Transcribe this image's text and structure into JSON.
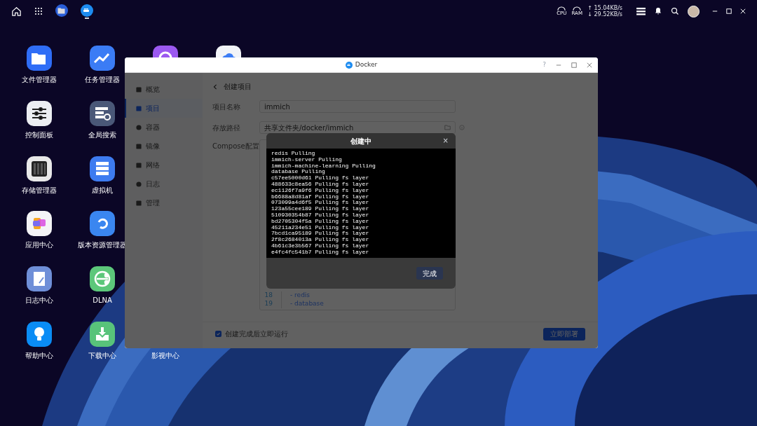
{
  "taskbar": {
    "apps": [
      {
        "kind": "files",
        "selected": false
      },
      {
        "kind": "docker",
        "selected": true
      }
    ],
    "cpu_label": "CPU",
    "ram_label": "RAM",
    "upload": "↑ 15.04KB/s",
    "download": "↓ 29.52KB/s"
  },
  "desktop": {
    "columns": [
      [
        {
          "kind": "files",
          "label": "文件管理器"
        },
        {
          "kind": "control",
          "label": "控制面板"
        },
        {
          "kind": "storage",
          "label": "存储管理器"
        },
        {
          "kind": "apps",
          "label": "应用中心"
        },
        {
          "kind": "logs",
          "label": "日志中心"
        },
        {
          "kind": "help",
          "label": "帮助中心"
        }
      ],
      [
        {
          "kind": "tasks",
          "label": "任务管理器"
        },
        {
          "kind": "search",
          "label": "全局搜索"
        },
        {
          "kind": "vm",
          "label": "虚拟机"
        },
        {
          "kind": "versions",
          "label": "版本资源管理器"
        },
        {
          "kind": "dlna",
          "label": "DLNA"
        },
        {
          "kind": "download",
          "label": "下载中心"
        }
      ],
      [
        {
          "kind": "player"
        },
        {
          "label": "影视中心"
        }
      ],
      [
        {
          "kind": "cloud"
        }
      ]
    ]
  },
  "window": {
    "title": "Docker",
    "help": "?",
    "sidebar": [
      {
        "label": "概览",
        "selected": false
      },
      {
        "label": "项目",
        "selected": true
      },
      {
        "label": "容器",
        "selected": false
      },
      {
        "label": "镜像",
        "selected": false
      },
      {
        "label": "网络",
        "selected": false
      },
      {
        "label": "日志",
        "selected": false
      },
      {
        "label": "管理",
        "selected": false
      }
    ],
    "page_title": "创建项目",
    "fields": [
      {
        "label": "项目名称",
        "value": "immich"
      },
      {
        "label": "存放路径",
        "value": "共享文件夹/docker/immich"
      }
    ],
    "compose_label": "Compose配置",
    "code_lines": [
      {
        "number": "18",
        "text": "- redis",
        "indent": true
      },
      {
        "number": "19",
        "text": "- database",
        "indent": true
      }
    ],
    "run_after": {
      "label": "创建完成后立即运行",
      "checked": true
    },
    "deploy_button": "立即部署"
  },
  "dialog": {
    "title": "创建中",
    "close": "×",
    "log": [
      "redis Pulling",
      "immich-server Pulling",
      "immich-machine-learning Pulling",
      "database Pulling",
      "c57ee5000d61 Pulling fs layer",
      "488633c8ea56 Pulling fs layer",
      "ec1126f7a9f6 Pulling fs layer",
      "b6688a8d81af Pulling fs layer",
      "073099a4d6f5 Pulling fs layer",
      "123a55cee189 Pulling fs layer",
      "510930354b87 Pulling fs layer",
      "bd2705304f5a Pulling fs layer",
      "45211a234e51 Pulling fs layer",
      "7bcd1ca95189 Pulling fs layer",
      "2f8c2684013a Pulling fs layer",
      "4b61c3e3b567 Pulling fs layer",
      "e4fc4fc541b7 Pulling fs layer"
    ],
    "done_button": "完成"
  }
}
